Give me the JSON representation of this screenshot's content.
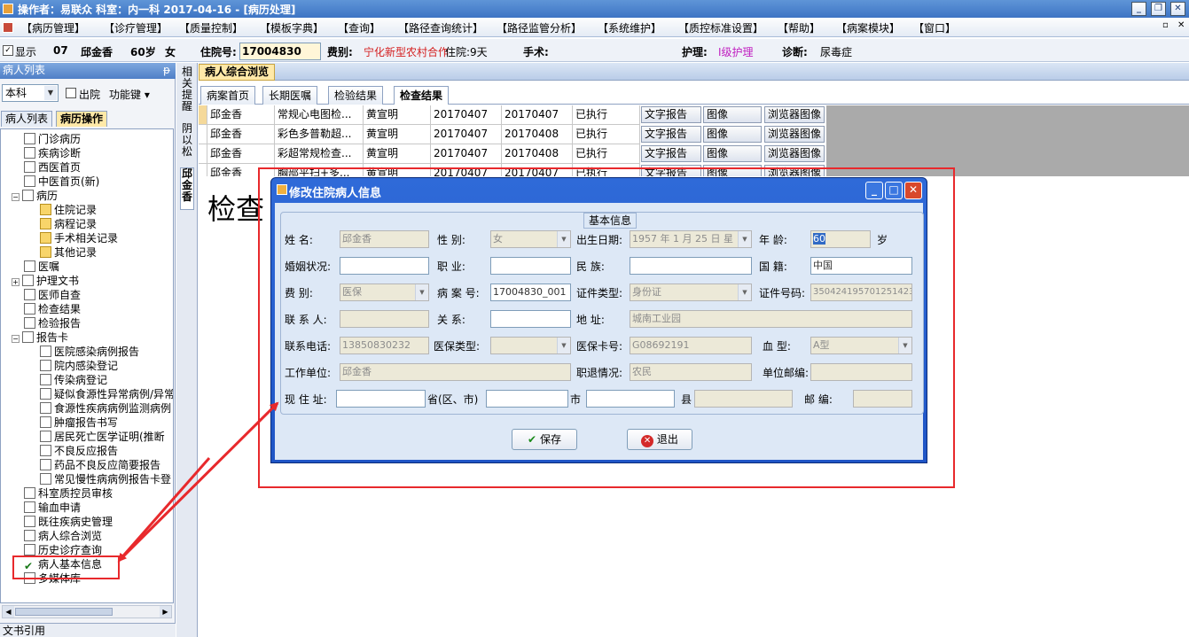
{
  "titlebar": {
    "text": "操作者：易联众  科室：内一科  2017-04-16 - [病历处理]"
  },
  "menu": [
    "【病历管理】",
    "【诊疗管理】",
    "【质量控制】",
    "【模板字典】",
    "【查询】",
    "【路径查询统计】",
    "【路径监管分析】",
    "【系统维护】",
    "【质控标准设置】",
    "【帮助】",
    "【病案模块】",
    "【窗口】"
  ],
  "patient": {
    "show_label": "显示",
    "bed": "07",
    "name": "邱金香",
    "age": "60岁",
    "sex": "女",
    "admission_label": "住院号:",
    "admission_no": "17004830",
    "fee_label": "费别:",
    "fee_value": "宁化新型农村合作",
    "days": "住院:9天",
    "surgery_label": "手术:",
    "nursing_label": "护理:",
    "nursing_value": "I级护理",
    "diagnosis_label": "诊断:",
    "diagnosis_value": "尿毒症"
  },
  "left": {
    "panel_title": "病人列表",
    "dept": "本科",
    "discharge_label": "出院",
    "func_label": "功能键",
    "tabs": [
      "病人列表",
      "病历操作"
    ],
    "tree": [
      "门诊病历",
      "疾病诊断",
      "西医首页",
      "中医首页(新)",
      "病历",
      "住院记录",
      "病程记录",
      "手术相关记录",
      "其他记录",
      "医嘱",
      "护理文书",
      "医师自查",
      "检查结果",
      "检验报告",
      "报告卡",
      "医院感染病例报告",
      "院内感染登记",
      "传染病登记",
      "疑似食源性异常病例/异常",
      "食源性疾病病例监测病例",
      "肿瘤报告书写",
      "居民死亡医学证明(推断",
      "不良反应报告",
      "药品不良反应简要报告",
      "常见慢性病病例报告卡登",
      "科室质控员审核",
      "输血申请",
      "既往疾病史管理",
      "病人综合浏览",
      "历史诊疗查询",
      "病人基本信息",
      "多媒体库"
    ],
    "footer": "文书引用"
  },
  "vstrip": {
    "tab1": "相关提醒",
    "tab2": "阴以松",
    "tab3": "邱金香"
  },
  "main": {
    "header_tab": "病人综合浏览",
    "subtabs": [
      "病案首页",
      "长期医嘱",
      "检验结果",
      "检查结果"
    ],
    "rows": [
      {
        "name": "邱金香",
        "item": "常规心电图检...",
        "doctor": "黄宣明",
        "d1": "20170407",
        "d2": "20170407",
        "status": "已执行"
      },
      {
        "name": "邱金香",
        "item": "彩色多普勒超...",
        "doctor": "黄宣明",
        "d1": "20170407",
        "d2": "20170408",
        "status": "已执行"
      },
      {
        "name": "邱金香",
        "item": "彩超常规检查...",
        "doctor": "黄宣明",
        "d1": "20170407",
        "d2": "20170408",
        "status": "已执行"
      },
      {
        "name": "邱金香",
        "item": "胸部平扫+多...",
        "doctor": "黄宣明",
        "d1": "20170407",
        "d2": "20170407",
        "status": "已执行"
      }
    ],
    "btn_text": "文字报告",
    "btn_image": "图像",
    "btn_browser": "浏览器图像",
    "big_text": "检查"
  },
  "dialog": {
    "title": "修改住院病人信息",
    "group": "基本信息",
    "labels": {
      "name": "姓    名:",
      "sex": "性    别:",
      "birth": "出生日期:",
      "age": "年    龄:",
      "age_unit": "岁",
      "marital": "婚姻状况:",
      "job": "职    业:",
      "nation": "民    族:",
      "country": "国    籍:",
      "fee": "费    别:",
      "caseno": "病 案 号:",
      "idtype": "证件类型:",
      "idno": "证件号码:",
      "contact": "联 系 人:",
      "relation": "关    系:",
      "address": "地    址:",
      "phone": "联系电话:",
      "insurtype": "医保类型:",
      "insurcard": "医保卡号:",
      "blood": "血    型:",
      "work": "工作单位:",
      "retire": "职退情况:",
      "postcode_work": "单位邮编:",
      "curaddr": "现 住 址:",
      "province": "省(区、市)",
      "city": "市",
      "county": "县",
      "postcode": "邮    编:"
    },
    "values": {
      "name": "邱金香",
      "sex": "女",
      "birth": "1957 年 1 月 25 日 星",
      "age": "60",
      "country": "中国",
      "fee": "医保",
      "caseno": "17004830_001",
      "idtype": "身份证",
      "idno": "350424195701251423",
      "address": "城南工业园",
      "phone": "13850830232",
      "insurcard": "G08692191",
      "blood": "A型",
      "work": "邱金香",
      "retire": "农民"
    },
    "save": "保存",
    "exit": "退出"
  }
}
